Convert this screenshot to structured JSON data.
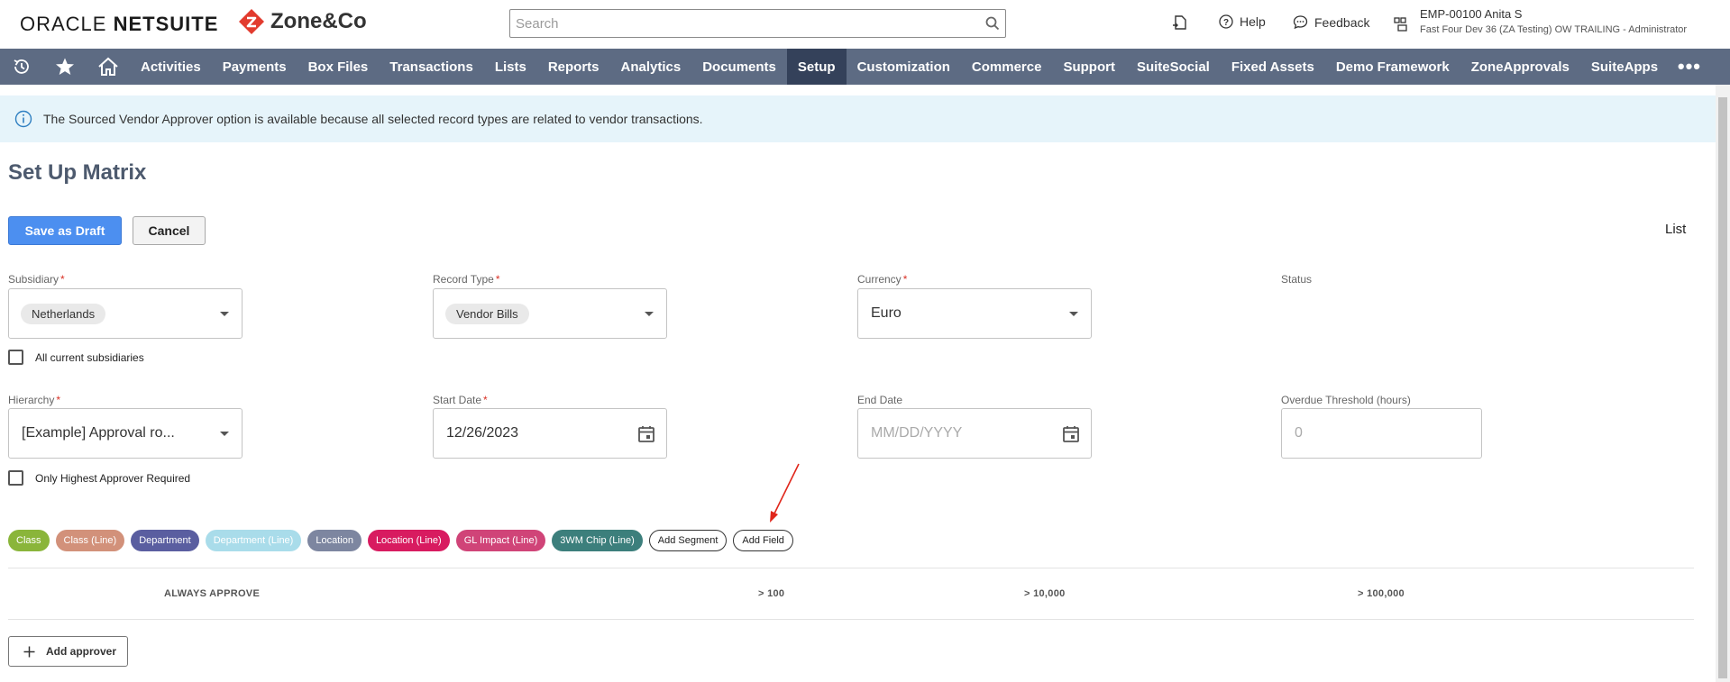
{
  "header": {
    "oracle_prefix": "ORACLE ",
    "oracle_suffix": "NETSUITE",
    "zone_brand": "Zone&Co",
    "search_placeholder": "Search",
    "help_label": "Help",
    "feedback_label": "Feedback",
    "user_name": "EMP-00100 Anita S",
    "user_role": "Fast Four Dev 36 (ZA Testing) OW TRAILING - Administrator"
  },
  "nav": {
    "items": [
      "Activities",
      "Payments",
      "Box Files",
      "Transactions",
      "Lists",
      "Reports",
      "Analytics",
      "Documents",
      "Setup",
      "Customization",
      "Commerce",
      "Support",
      "SuiteSocial",
      "Fixed Assets",
      "Demo Framework",
      "ZoneApprovals",
      "SuiteApps"
    ],
    "active": "Setup",
    "more": "•••"
  },
  "banner": {
    "text": "The Sourced Vendor Approver option is available because all selected record types are related to vendor transactions."
  },
  "page": {
    "title": "Set Up Matrix",
    "save_draft": "Save as Draft",
    "cancel": "Cancel",
    "list_link": "List"
  },
  "form": {
    "subsidiary": {
      "label": "Subsidiary",
      "value": "Netherlands"
    },
    "all_subsidiaries": "All current subsidiaries",
    "record_type": {
      "label": "Record Type",
      "value": "Vendor Bills"
    },
    "currency": {
      "label": "Currency",
      "value": "Euro"
    },
    "status": {
      "label": "Status"
    },
    "hierarchy": {
      "label": "Hierarchy",
      "value": "[Example] Approval ro..."
    },
    "only_highest": "Only Highest Approver Required",
    "start_date": {
      "label": "Start Date",
      "value": "12/26/2023"
    },
    "end_date": {
      "label": "End Date",
      "placeholder": "MM/DD/YYYY"
    },
    "overdue": {
      "label": "Overdue Threshold (hours)",
      "placeholder": "0"
    }
  },
  "segments": [
    {
      "label": "Class",
      "color": "#8ab53a"
    },
    {
      "label": "Class (Line)",
      "color": "#d2917a"
    },
    {
      "label": "Department",
      "color": "#5a5ea0"
    },
    {
      "label": "Department (Line)",
      "color": "#a9dcea"
    },
    {
      "label": "Location",
      "color": "#7d86a0"
    },
    {
      "label": "Location (Line)",
      "color": "#d81b60"
    },
    {
      "label": "GL Impact (Line)",
      "color": "#d04478"
    },
    {
      "label": "3WM Chip (Line)",
      "color": "#3c7f7c"
    }
  ],
  "segment_actions": {
    "add_segment": "Add Segment",
    "add_field": "Add Field"
  },
  "matrix": {
    "columns": [
      "ALWAYS APPROVE",
      "> 100",
      "> 10,000",
      "> 100,000"
    ]
  },
  "add_approver": "Add approver"
}
